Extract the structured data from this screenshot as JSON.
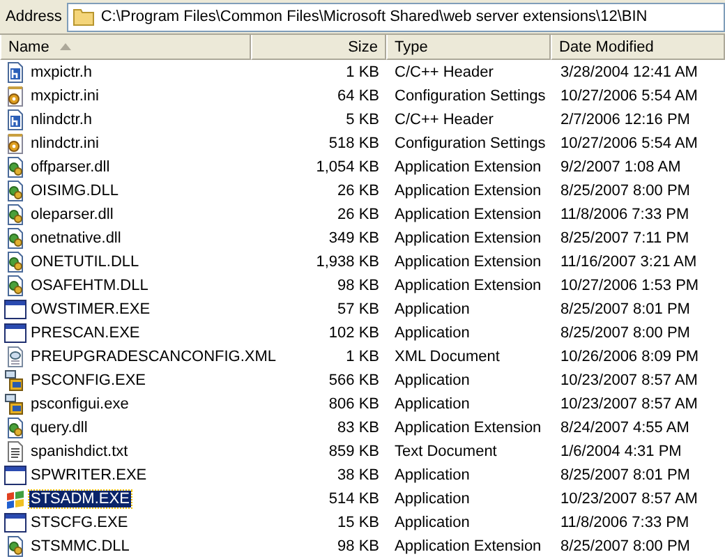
{
  "address_bar": {
    "label": "Address",
    "path": "C:\\Program Files\\Common Files\\Microsoft Shared\\web server extensions\\12\\BIN"
  },
  "columns": [
    {
      "label": "Name",
      "sorted": true
    },
    {
      "label": "Size",
      "sorted": false
    },
    {
      "label": "Type",
      "sorted": false
    },
    {
      "label": "Date Modified",
      "sorted": false
    }
  ],
  "files": [
    {
      "kind": "header",
      "name": "mxpictr.h",
      "size": "1 KB",
      "type": "C/C++ Header",
      "date": "3/28/2004 12:41 AM",
      "selected": false
    },
    {
      "kind": "settings",
      "name": "mxpictr.ini",
      "size": "64 KB",
      "type": "Configuration Settings",
      "date": "10/27/2006 5:54 AM",
      "selected": false
    },
    {
      "kind": "header",
      "name": "nlindctr.h",
      "size": "5 KB",
      "type": "C/C++ Header",
      "date": "2/7/2006 12:16 PM",
      "selected": false
    },
    {
      "kind": "settings",
      "name": "nlindctr.ini",
      "size": "518 KB",
      "type": "Configuration Settings",
      "date": "10/27/2006 5:54 AM",
      "selected": false
    },
    {
      "kind": "library",
      "name": "offparser.dll",
      "size": "1,054 KB",
      "type": "Application Extension",
      "date": "9/2/2007 1:08 AM",
      "selected": false
    },
    {
      "kind": "library",
      "name": "OISIMG.DLL",
      "size": "26 KB",
      "type": "Application Extension",
      "date": "8/25/2007 8:00 PM",
      "selected": false
    },
    {
      "kind": "library",
      "name": "oleparser.dll",
      "size": "26 KB",
      "type": "Application Extension",
      "date": "11/8/2006 7:33 PM",
      "selected": false
    },
    {
      "kind": "library",
      "name": "onetnative.dll",
      "size": "349 KB",
      "type": "Application Extension",
      "date": "8/25/2007 7:11 PM",
      "selected": false
    },
    {
      "kind": "library",
      "name": "ONETUTIL.DLL",
      "size": "1,938 KB",
      "type": "Application Extension",
      "date": "11/16/2007 3:21 AM",
      "selected": false
    },
    {
      "kind": "library",
      "name": "OSAFEHTM.DLL",
      "size": "98 KB",
      "type": "Application Extension",
      "date": "10/27/2006 1:53 PM",
      "selected": false
    },
    {
      "kind": "program",
      "name": "OWSTIMER.EXE",
      "size": "57 KB",
      "type": "Application",
      "date": "8/25/2007 8:01 PM",
      "selected": false
    },
    {
      "kind": "program",
      "name": "PRESCAN.EXE",
      "size": "102 KB",
      "type": "Application",
      "date": "8/25/2007 8:00 PM",
      "selected": false
    },
    {
      "kind": "xml",
      "name": "PREUPGRADESCANCONFIG.XML",
      "size": "1 KB",
      "type": "XML Document",
      "date": "10/26/2006 8:09 PM",
      "selected": false
    },
    {
      "kind": "setup",
      "name": "PSCONFIG.EXE",
      "size": "566 KB",
      "type": "Application",
      "date": "10/23/2007 8:57 AM",
      "selected": false
    },
    {
      "kind": "setup",
      "name": "psconfigui.exe",
      "size": "806 KB",
      "type": "Application",
      "date": "10/23/2007 8:57 AM",
      "selected": false
    },
    {
      "kind": "library",
      "name": "query.dll",
      "size": "83 KB",
      "type": "Application Extension",
      "date": "8/24/2007 4:55 AM",
      "selected": false
    },
    {
      "kind": "text",
      "name": "spanishdict.txt",
      "size": "859 KB",
      "type": "Text Document",
      "date": "1/6/2004 4:31 PM",
      "selected": false
    },
    {
      "kind": "program",
      "name": "SPWRITER.EXE",
      "size": "38 KB",
      "type": "Application",
      "date": "8/25/2007 8:01 PM",
      "selected": false
    },
    {
      "kind": "flag",
      "name": "STSADM.EXE",
      "size": "514 KB",
      "type": "Application",
      "date": "10/23/2007 8:57 AM",
      "selected": true
    },
    {
      "kind": "program",
      "name": "STSCFG.EXE",
      "size": "15 KB",
      "type": "Application",
      "date": "11/8/2006 7:33 PM",
      "selected": false
    },
    {
      "kind": "library",
      "name": "STSMMC.DLL",
      "size": "98 KB",
      "type": "Application Extension",
      "date": "8/25/2007 8:00 PM",
      "selected": false
    }
  ]
}
